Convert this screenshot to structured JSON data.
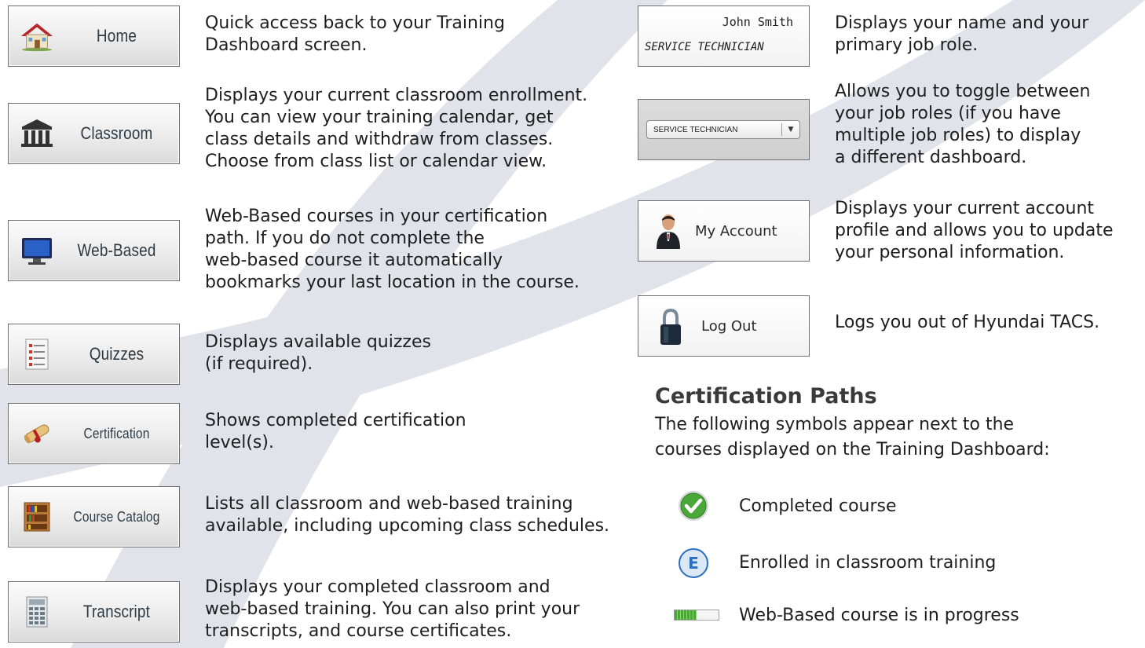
{
  "left_items": [
    {
      "label": "Home",
      "icon": "house-icon",
      "description": "Quick access back to your Training\nDashboard screen."
    },
    {
      "label": "Classroom",
      "icon": "classroom-building-icon",
      "description": "Displays your current classroom enrollment.\nYou can view your training calendar, get\nclass details and withdraw from classes.\nChoose from class list or calendar view."
    },
    {
      "label": "Web-Based",
      "icon": "monitor-icon",
      "description": "Web-Based courses in your certification\npath. If you do not complete the\nweb-based course it automatically\nbookmarks your last location in the course."
    },
    {
      "label": "Quizzes",
      "icon": "quiz-document-icon",
      "description": "Displays available quizzes\n(if required)."
    },
    {
      "label": "Certification",
      "icon": "diploma-scroll-icon",
      "description": "Shows completed certification\nlevel(s)."
    },
    {
      "label": "Course Catalog",
      "icon": "bookshelf-icon",
      "description": "Lists all classroom and web-based training\navailable, including upcoming class schedules."
    },
    {
      "label": "Transcript",
      "icon": "transcript-calculator-icon",
      "description": "Displays your completed classroom and\nweb-based training. You can also print your\ntranscripts, and course certificates."
    }
  ],
  "profile": {
    "name": "John Smith",
    "role": "SERVICE TECHNICIAN",
    "description": "Displays your name and your\nprimary job role."
  },
  "role_toggle": {
    "selected": "SERVICE TECHNICIAN",
    "description": "Allows you to toggle between\nyour job roles (if you have\nmultiple job roles) to display\na different dashboard."
  },
  "my_account": {
    "label": "My Account",
    "icon": "user-avatar-icon",
    "description": "Displays your current account\nprofile and allows you to update\nyour personal information."
  },
  "log_out": {
    "label": "Log Out",
    "icon": "padlock-icon",
    "description": "Logs you out of Hyundai TACS."
  },
  "certification_paths": {
    "title": "Certification Paths",
    "intro": "The following symbols appear next to the\ncourses displayed on the Training Dashboard:",
    "legend": [
      {
        "icon": "green-check-icon",
        "text": "Completed course"
      },
      {
        "icon": "enrolled-e-icon",
        "symbol": "E",
        "text": "Enrolled in classroom training"
      },
      {
        "icon": "progress-bar-icon",
        "text": "Web-Based course is in progress",
        "progress": 0.5
      }
    ]
  },
  "colors": {
    "swoosh": "#e3e3ec",
    "check_green": "#4aa83a",
    "enrolled_blue": "#2a6fc0",
    "progress_green": "#3fae2a"
  }
}
